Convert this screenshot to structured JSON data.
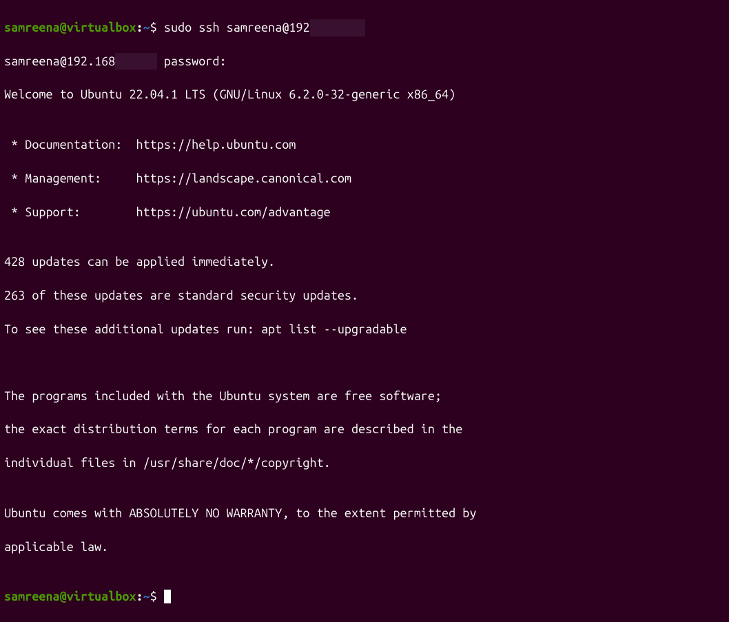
{
  "prompt1": {
    "user_host": "samreena@virtualbox",
    "colon": ":",
    "path": "~",
    "dollar": "$ ",
    "command": "sudo ssh samreena@192",
    "redacted1": "        "
  },
  "lines": {
    "pw_prompt_prefix": "samreena@192.168",
    "pw_redacted": "      ",
    "pw_prompt_suffix": " password:",
    "welcome": "Welcome to Ubuntu 22.04.1 LTS (GNU/Linux 6.2.0-32-generic x86_64)",
    "blank": "",
    "doc": " * Documentation:  https://help.ubuntu.com",
    "mgmt": " * Management:     https://landscape.canonical.com",
    "supp": " * Support:        https://ubuntu.com/advantage",
    "upd1": "428 updates can be applied immediately.",
    "upd2": "263 of these updates are standard security updates.",
    "upd3": "To see these additional updates run: apt list --upgradable",
    "prog1": "The programs included with the Ubuntu system are free software;",
    "prog2": "the exact distribution terms for each program are described in the",
    "prog3": "individual files in /usr/share/doc/*/copyright.",
    "warr1": "Ubuntu comes with ABSOLUTELY NO WARRANTY, to the extent permitted by",
    "warr2": "applicable law.",
    "blank2": ""
  },
  "prompt2": {
    "user_host": "samreena@virtualbox",
    "colon": ":",
    "path": "~",
    "dollar": "$ "
  }
}
